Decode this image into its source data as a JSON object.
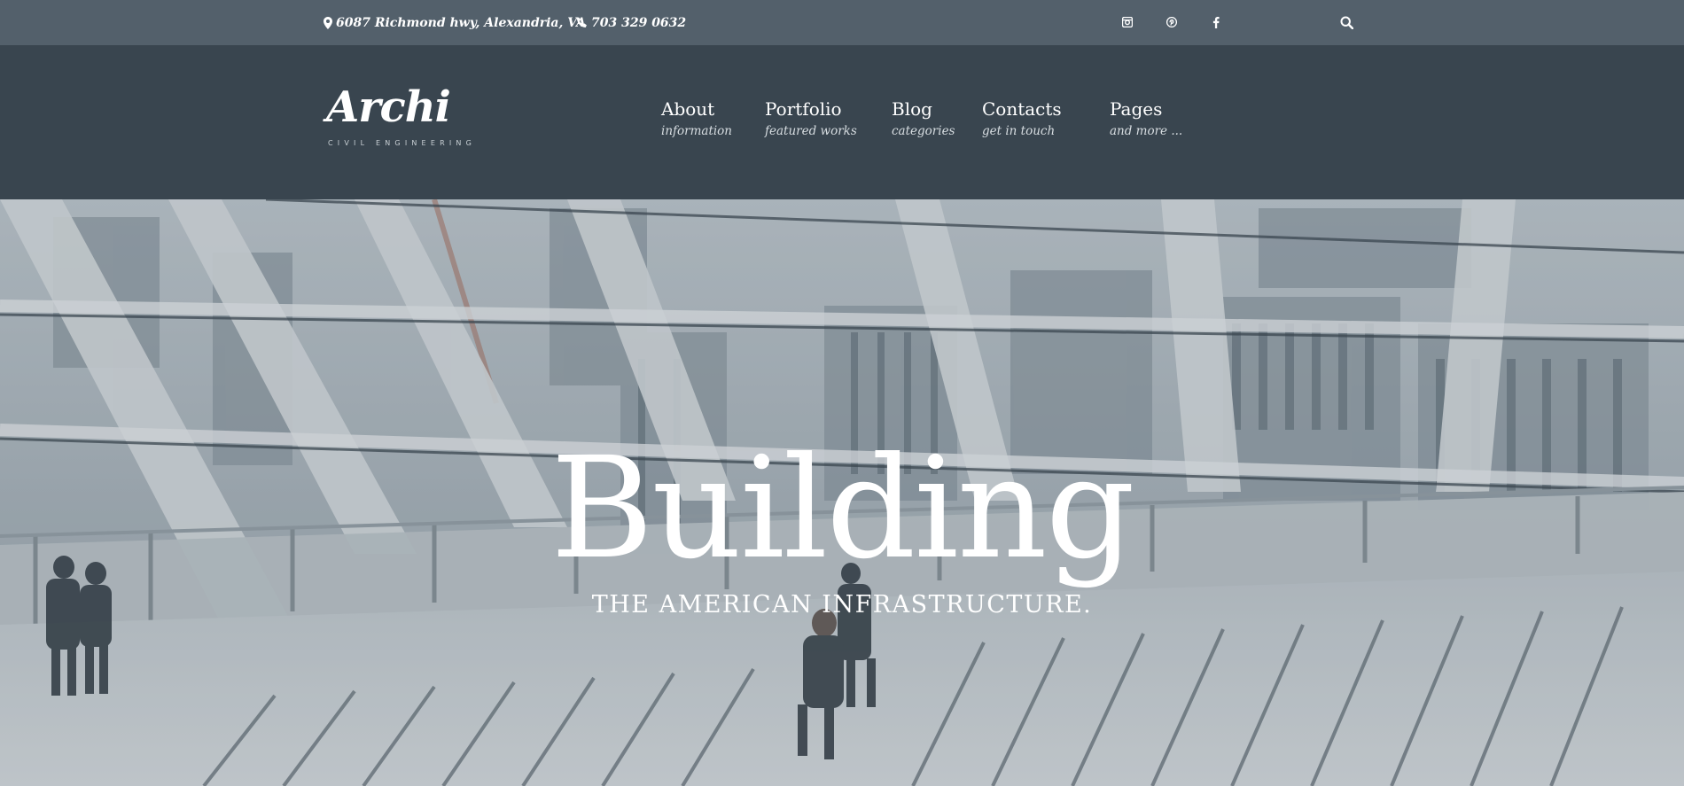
{
  "topbar": {
    "address": "6087 Richmond hwy, Alexandria, VA",
    "phone": "703 329 0632",
    "social": [
      "instagram-icon",
      "pinterest-icon",
      "facebook-icon"
    ],
    "search_icon": "search-icon"
  },
  "header": {
    "logo_text": "Archi",
    "logo_tagline": "CIVIL ENGINEERING",
    "nav": [
      {
        "label": "About",
        "sub": "information"
      },
      {
        "label": "Portfolio",
        "sub": "featured works"
      },
      {
        "label": "Blog",
        "sub": "categories"
      },
      {
        "label": "Contacts",
        "sub": "get in touch"
      },
      {
        "label": "Pages",
        "sub": "and more ..."
      }
    ]
  },
  "hero": {
    "title": "Building",
    "subtitle": "THE AMERICAN INFRASTRUCTURE."
  },
  "colors": {
    "topbar_bg": "#53606b",
    "header_bg": "#39454f",
    "text": "#ffffff"
  }
}
